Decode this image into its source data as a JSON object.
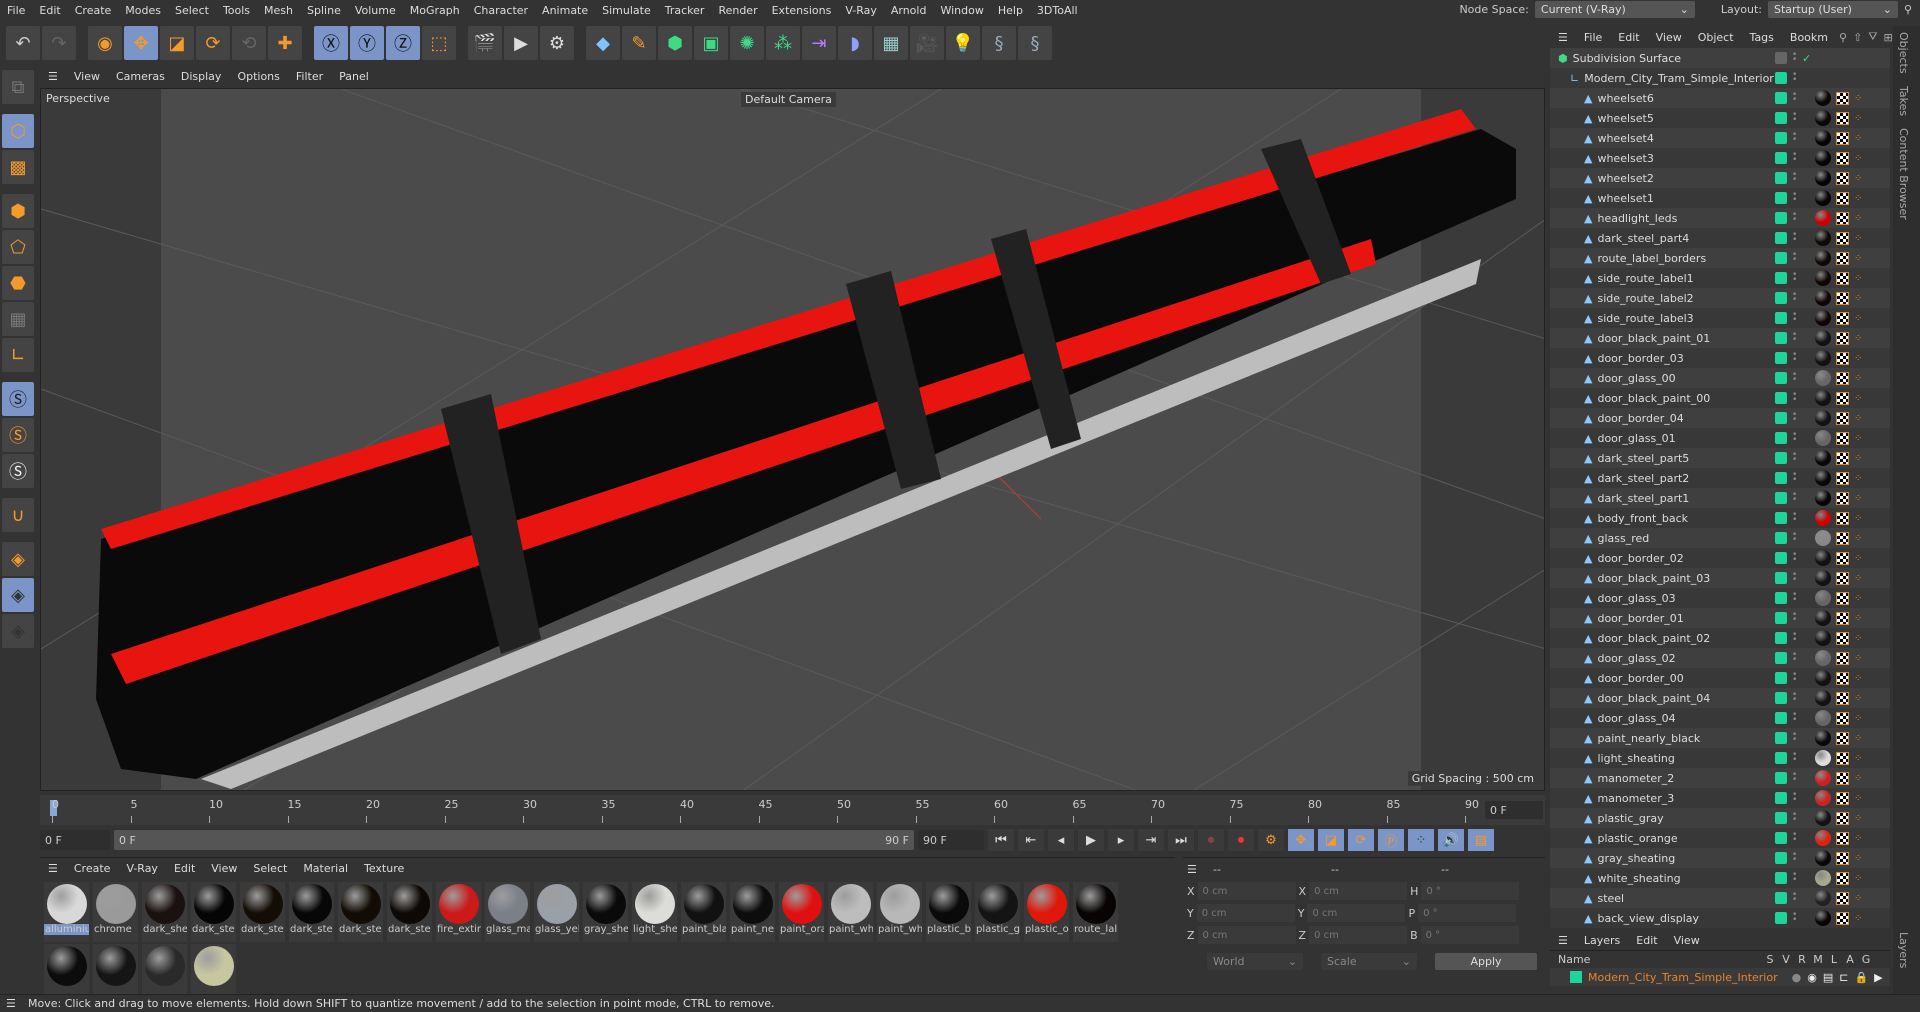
{
  "menubar": {
    "items": [
      "File",
      "Edit",
      "Create",
      "Modes",
      "Select",
      "Tools",
      "Mesh",
      "Spline",
      "Volume",
      "MoGraph",
      "Character",
      "Animate",
      "Simulate",
      "Tracker",
      "Render",
      "Extensions",
      "V-Ray",
      "Arnold",
      "Window",
      "Help",
      "3DToAll"
    ],
    "node_space_label": "Node Space:",
    "node_space_value": "Current (V-Ray)",
    "layout_label": "Layout:",
    "layout_value": "Startup (User)"
  },
  "viewport": {
    "menu": [
      "View",
      "Cameras",
      "Display",
      "Options",
      "Filter",
      "Panel"
    ],
    "view_name": "Perspective",
    "camera": "Default Camera",
    "grid_spacing": "Grid Spacing : 500 cm"
  },
  "timeline": {
    "ticks": [
      "0",
      "5",
      "10",
      "15",
      "20",
      "25",
      "30",
      "35",
      "40",
      "45",
      "50",
      "55",
      "60",
      "65",
      "70",
      "75",
      "80",
      "85",
      "90"
    ],
    "current_frame": "0 F",
    "start_field": "0 F",
    "range_start": "0 F",
    "range_end": "90 F",
    "end_field": "90 F"
  },
  "materials": {
    "menu": [
      "Create",
      "V-Ray",
      "Edit",
      "View",
      "Select",
      "Material",
      "Texture"
    ],
    "items": [
      {
        "name": "alluminiu",
        "color": "#d8d8d8",
        "selected": true
      },
      {
        "name": "chrome",
        "color": "#9a9a9a"
      },
      {
        "name": "dark_she",
        "color": "#1a1210"
      },
      {
        "name": "dark_ste",
        "color": "#050505"
      },
      {
        "name": "dark_ste",
        "color": "#130d08"
      },
      {
        "name": "dark_ste",
        "color": "#070707"
      },
      {
        "name": "dark_ste",
        "color": "#120c06"
      },
      {
        "name": "dark_ste",
        "color": "#0d0906"
      },
      {
        "name": "fire_extir",
        "color": "#cc1a1a"
      },
      {
        "name": "glass_ma",
        "color": "#7a7f88"
      },
      {
        "name": "glass_yel",
        "color": "#9aa0a8"
      },
      {
        "name": "gray_she",
        "color": "#0a0a0a"
      },
      {
        "name": "light_she",
        "color": "#dcdcd8"
      },
      {
        "name": "paint_bla",
        "color": "#111"
      },
      {
        "name": "paint_ne",
        "color": "#0d0d0d"
      },
      {
        "name": "paint_ora",
        "color": "#e01010"
      },
      {
        "name": "paint_wh",
        "color": "#bdbdbd"
      },
      {
        "name": "paint_wh",
        "color": "#b8b8b8"
      },
      {
        "name": "plastic_b",
        "color": "#0a0a0a"
      },
      {
        "name": "plastic_g",
        "color": "#141414"
      },
      {
        "name": "plastic_o",
        "color": "#e0180a"
      },
      {
        "name": "route_lal",
        "color": "#080404"
      },
      {
        "name": "",
        "color": "#0c0c0c"
      },
      {
        "name": "",
        "color": "#151515"
      },
      {
        "name": "",
        "color": "#2a2a2a"
      },
      {
        "name": "",
        "color": "#c6c6a0"
      }
    ]
  },
  "coords": {
    "headers": [
      "--",
      "--",
      "--"
    ],
    "rows": [
      {
        "a": "X",
        "av": "0 cm",
        "b": "X",
        "bv": "0 cm",
        "c": "H",
        "cv": "0 °"
      },
      {
        "a": "Y",
        "av": "0 cm",
        "b": "Y",
        "bv": "0 cm",
        "c": "P",
        "cv": "0 °"
      },
      {
        "a": "Z",
        "av": "0 cm",
        "b": "Z",
        "bv": "0 cm",
        "c": "B",
        "cv": "0 °"
      }
    ],
    "world": "World",
    "scale": "Scale",
    "apply": "Apply"
  },
  "objects": {
    "menu": [
      "File",
      "Edit",
      "View",
      "Object",
      "Tags",
      "Bookm"
    ],
    "root": "Subdivision Surface",
    "group": "Modern_City_Tram_Simple_Interior",
    "items": [
      {
        "name": "wheelset6",
        "mat": "#0a0806"
      },
      {
        "name": "wheelset5",
        "mat": "#0a0806"
      },
      {
        "name": "wheelset4",
        "mat": "#050505"
      },
      {
        "name": "wheelset3",
        "mat": "#050505"
      },
      {
        "name": "wheelset2",
        "mat": "#050505"
      },
      {
        "name": "wheelset1",
        "mat": "#050505"
      },
      {
        "name": "headlight_leds",
        "mat": "#c00"
      },
      {
        "name": "dark_steel_part4",
        "mat": "#0d0906"
      },
      {
        "name": "route_label_borders",
        "mat": "#0d0906"
      },
      {
        "name": "side_route_label1",
        "mat": "#100505"
      },
      {
        "name": "side_route_label2",
        "mat": "#100505"
      },
      {
        "name": "side_route_label3",
        "mat": "#100505"
      },
      {
        "name": "door_black_paint_01",
        "mat": "#111"
      },
      {
        "name": "door_border_03",
        "mat": "#111"
      },
      {
        "name": "door_glass_00",
        "mat": "#666"
      },
      {
        "name": "door_black_paint_00",
        "mat": "#111"
      },
      {
        "name": "door_border_04",
        "mat": "#111"
      },
      {
        "name": "door_glass_01",
        "mat": "#666"
      },
      {
        "name": "dark_steel_part5",
        "mat": "#080808"
      },
      {
        "name": "dark_steel_part2",
        "mat": "#080808"
      },
      {
        "name": "dark_steel_part1",
        "mat": "#050505"
      },
      {
        "name": "body_front_back",
        "mat": "#c00"
      },
      {
        "name": "glass_red",
        "mat": "#888"
      },
      {
        "name": "door_border_02",
        "mat": "#111"
      },
      {
        "name": "door_black_paint_03",
        "mat": "#111"
      },
      {
        "name": "door_glass_03",
        "mat": "#666"
      },
      {
        "name": "door_border_01",
        "mat": "#111"
      },
      {
        "name": "door_black_paint_02",
        "mat": "#111"
      },
      {
        "name": "door_glass_02",
        "mat": "#666"
      },
      {
        "name": "door_border_00",
        "mat": "#111"
      },
      {
        "name": "door_black_paint_04",
        "mat": "#111"
      },
      {
        "name": "door_glass_04",
        "mat": "#666"
      },
      {
        "name": "paint_nearly_black",
        "mat": "#0a0a0a"
      },
      {
        "name": "light_sheating",
        "mat": "#ddd"
      },
      {
        "name": "manometer_2",
        "mat": "#c22"
      },
      {
        "name": "manometer_3",
        "mat": "#c22"
      },
      {
        "name": "plastic_gray",
        "mat": "#111"
      },
      {
        "name": "plastic_orange",
        "mat": "#d21"
      },
      {
        "name": "gray_sheating",
        "mat": "#080808"
      },
      {
        "name": "white_sheating",
        "mat": "#a8a890"
      },
      {
        "name": "steel",
        "mat": "#222"
      },
      {
        "name": "back_view_display",
        "mat": "#080404"
      }
    ]
  },
  "layers": {
    "menu": [
      "Layers",
      "Edit",
      "View"
    ],
    "headers": [
      "Name",
      "S",
      "V",
      "R",
      "M",
      "L",
      "A",
      "G"
    ],
    "layer_name": "Modern_City_Tram_Simple_Interior"
  },
  "sidetabs": [
    "Objects",
    "Takes",
    "Content Browser",
    "Layers"
  ],
  "status": "Move: Click and drag to move elements. Hold down SHIFT to quantize movement / add to the selection in point mode, CTRL to remove."
}
